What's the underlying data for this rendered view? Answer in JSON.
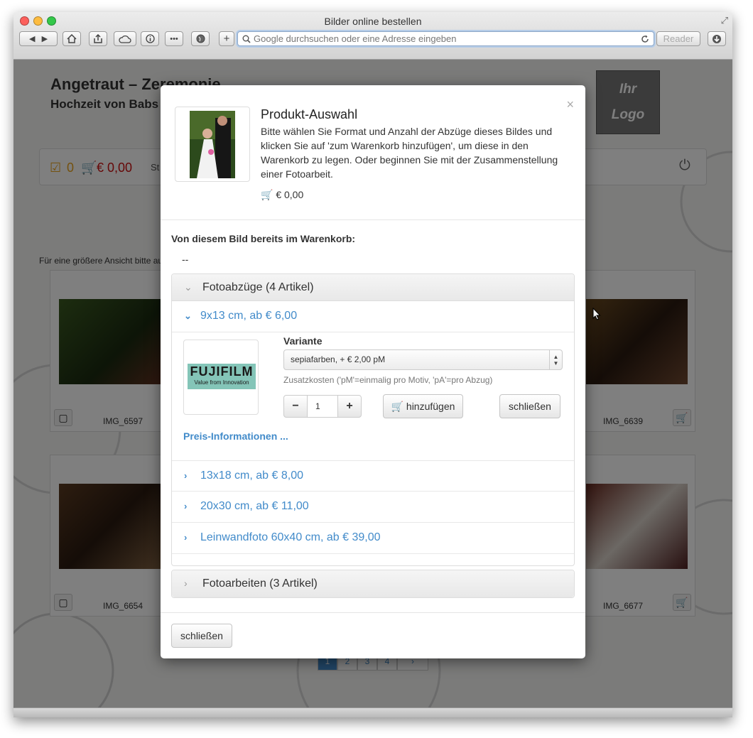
{
  "window": {
    "title": "Bilder online bestellen",
    "address_placeholder": "Google durchsuchen oder eine Adresse eingeben",
    "reader_label": "Reader"
  },
  "page": {
    "title": "Angetraut – Zeremonie",
    "subtitle": "Hochzeit von Babs",
    "logo_line1": "Ihr",
    "logo_line2": "Logo",
    "cart_checked_count": "0",
    "cart_total": "€ 0,00",
    "cart_bar_partial": "St",
    "hint_text": "Für eine größere Ansicht bitte au",
    "thumbnails": [
      {
        "caption": "IMG_6597"
      },
      {
        "caption": "IMG_6639"
      },
      {
        "caption": "IMG_6654"
      },
      {
        "caption": "IMG_6677"
      }
    ],
    "pager": [
      "1",
      "2",
      "3",
      "4",
      "›"
    ]
  },
  "modal": {
    "title": "Produkt-Auswahl",
    "description": "Bitte wählen Sie Format und Anzahl der Abzüge dieses Bildes und klicken Sie auf 'zum Warenkorb hinzufügen', um diese in den Warenkorb zu legen. Oder beginnen Sie mit der Zusammenstellung einer Fotoarbeit.",
    "price": "€ 0,00",
    "close_symbol": "×",
    "already_label": "Von diesem Bild bereits im Warenkorb:",
    "already_value": "--",
    "fotoabzuege": {
      "title": "Fotoabzüge (4 Artikel)",
      "items": [
        {
          "label": "9x13 cm, ab € 6,00"
        },
        {
          "label": "13x18 cm, ab € 8,00"
        },
        {
          "label": "20x30 cm, ab € 11,00"
        },
        {
          "label": "Leinwandfoto 60x40 cm, ab € 39,00"
        }
      ],
      "brand_name": "FUJIFILM",
      "brand_tagline": "Value from Innovation",
      "variante_label": "Variante",
      "variante_value": "sepiafarben, + € 2,00 pM",
      "zusatz_text": "Zusatzkosten ('pM'=einmalig pro Motiv, 'pA'=pro Abzug)",
      "quantity": "1",
      "minus_label": "−",
      "plus_label": "+",
      "add_label": "hinzufügen",
      "close_label": "schließen",
      "preis_link": "Preis-Informationen ..."
    },
    "fotoarbeiten": {
      "title": "Fotoarbeiten (3 Artikel)"
    },
    "footer_close": "schließen"
  }
}
